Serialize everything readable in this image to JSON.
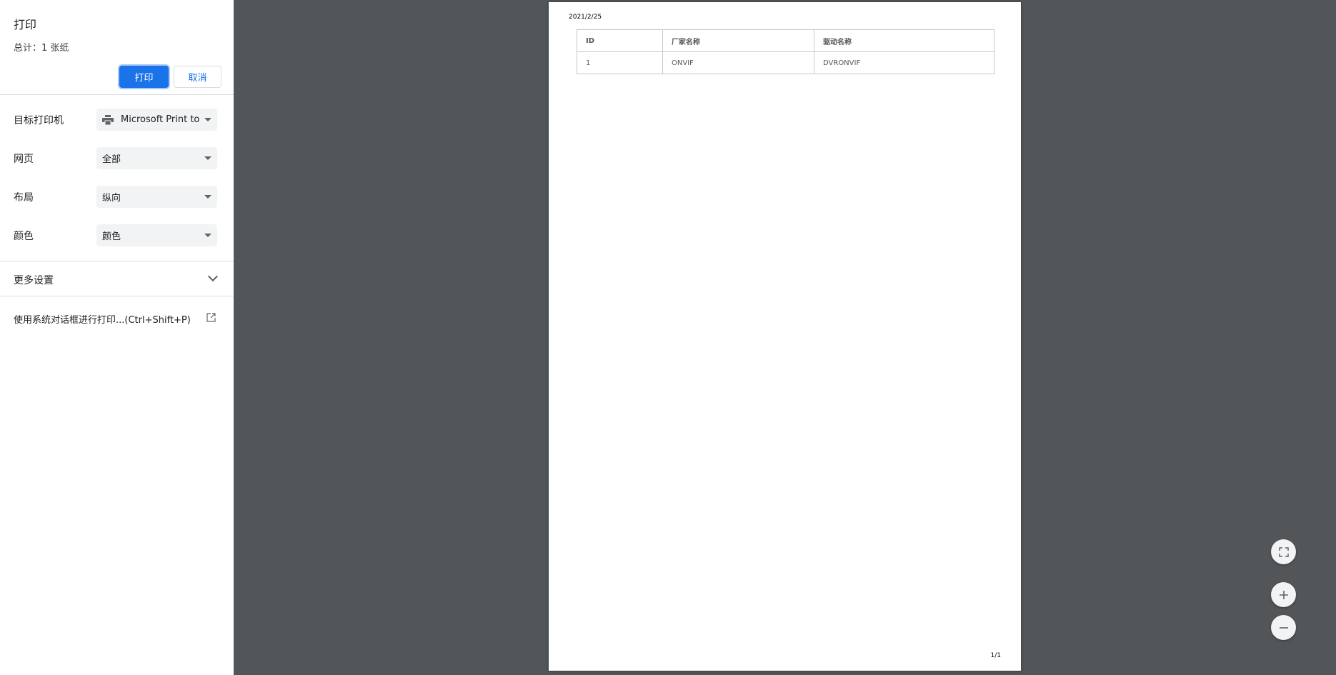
{
  "sidebar": {
    "title": "打印",
    "summary": "总计：1 张纸",
    "print_label": "打印",
    "cancel_label": "取消",
    "destination": {
      "label": "目标打印机",
      "value": "Microsoft Print to",
      "icon": "printer-icon"
    },
    "pages": {
      "label": "网页",
      "value": "全部"
    },
    "layout": {
      "label": "布局",
      "value": "纵向"
    },
    "color": {
      "label": "颜色",
      "value": "颜色"
    },
    "more_settings": "更多设置",
    "system_dialog": "使用系统对话框进行打印...(Ctrl+Shift+P)"
  },
  "preview": {
    "date": "2021/2/25",
    "table": {
      "headers": [
        "ID",
        "厂家名称",
        "驱动名称"
      ],
      "rows": [
        [
          "1",
          "ONVIF",
          "DVRONVIF"
        ]
      ]
    },
    "page_number": "1/1"
  },
  "colors": {
    "accent": "#1a73e8",
    "preview_bg": "#525659"
  }
}
